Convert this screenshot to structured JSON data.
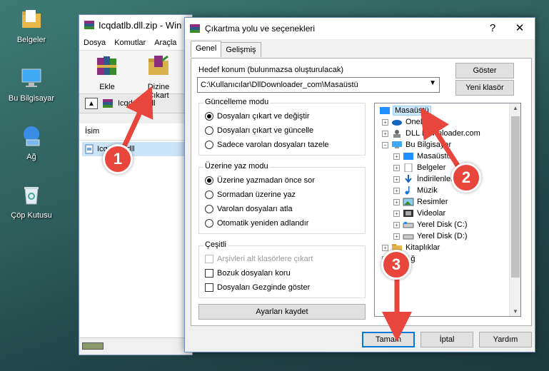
{
  "desktop": {
    "icons": [
      {
        "label": "Belgeler"
      },
      {
        "label": "Bu Bilgisayar"
      },
      {
        "label": "Ağ"
      },
      {
        "label": "Çöp Kutusu"
      }
    ]
  },
  "winrar": {
    "title": "Icqdatlb.dll.zip - Win",
    "menu": [
      "Dosya",
      "Komutlar",
      "Araçla"
    ],
    "tools": [
      "Ekle",
      "Dizine Çıkart"
    ],
    "path": "Icqdatlb.dll",
    "column_name": "İsim",
    "file": "Icqdatlb.dll"
  },
  "dialog": {
    "title": "Çıkartma yolu ve seçenekleri",
    "help": "?",
    "close": "✕",
    "tabs": [
      "Genel",
      "Gelişmiş"
    ],
    "dest_label": "Hedef konum (bulunmazsa oluşturulacak)",
    "dest_value": "C:\\Kullanıcılar\\DllDownloader_com\\Masaüstü",
    "show_button": "Göster",
    "new_folder_button": "Yeni klasör",
    "update_group": {
      "title": "Güncelleme modu",
      "options": [
        "Dosyaları çıkart ve değiştir",
        "Dosyaları çıkart ve güncelle",
        "Sadece varolan dosyaları tazele"
      ],
      "selected": 0
    },
    "overwrite_group": {
      "title": "Üzerine yaz modu",
      "options": [
        "Üzerine yazmadan önce sor",
        "Sormadan üzerine yaz",
        "Varolan dosyaları atla",
        "Otomatik yeniden adlandır"
      ],
      "selected": 0
    },
    "misc_group": {
      "title": "Çeşitli",
      "options": [
        "Arşivleri alt klasörlere çıkart",
        "Bozuk dosyaları koru",
        "Dosyaları Gezginde göster"
      ]
    },
    "save_button": "Ayarları kaydet",
    "tree": {
      "root": "Masaüstü",
      "items": [
        "OneDr",
        "DLL Downloader.com",
        "Bu Bilgisayar",
        "Masaüstü",
        "Belgeler",
        "İndirilenler",
        "Müzik",
        "Resimler",
        "Videolar",
        "Yerel Disk (C:)",
        "Yerel Disk (D:)",
        "Kitaplıklar",
        "Ağ"
      ]
    },
    "ok": "Tamam",
    "cancel": "İptal",
    "help_button": "Yardım"
  },
  "callouts": [
    "1",
    "2",
    "3"
  ],
  "colors": {
    "callout": "#e8463c",
    "accent": "#0078d7",
    "selection": "#cce8ff"
  }
}
